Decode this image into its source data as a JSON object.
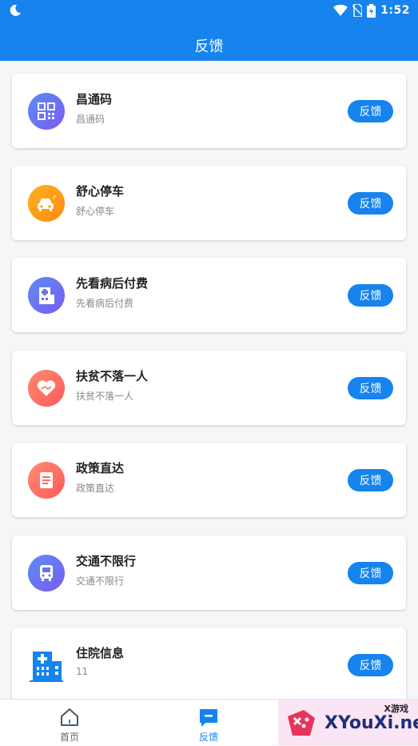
{
  "status_bar": {
    "time": "1:52"
  },
  "header": {
    "title": "反馈"
  },
  "items": [
    {
      "title": "昌通码",
      "subtitle": "昌通码",
      "button": "反馈",
      "icon": "qr-code-icon",
      "color": "#6a72f0"
    },
    {
      "title": "舒心停车",
      "subtitle": "舒心停车",
      "button": "反馈",
      "icon": "parking-car-icon",
      "color": "#ff9a1a"
    },
    {
      "title": "先看病后付费",
      "subtitle": "先看病后付费",
      "button": "反馈",
      "icon": "hospital-icon",
      "color": "#6a72f0"
    },
    {
      "title": "扶贫不落一人",
      "subtitle": "扶贫不落一人",
      "button": "反馈",
      "icon": "heart-handshake-icon",
      "color": "#ff6e5c"
    },
    {
      "title": "政策直达",
      "subtitle": "政策直达",
      "button": "反馈",
      "icon": "document-icon",
      "color": "#ff6e5c"
    },
    {
      "title": "交通不限行",
      "subtitle": "交通不限行",
      "button": "反馈",
      "icon": "bus-icon",
      "color": "#6a72f0"
    },
    {
      "title": "住院信息",
      "subtitle": "11",
      "button": "反馈",
      "icon": "hospital-building-icon",
      "color": "#1683ee"
    }
  ],
  "tabbar": {
    "tabs": [
      {
        "label": "首页",
        "icon": "home-icon",
        "active": false
      },
      {
        "label": "反馈",
        "icon": "feedback-icon",
        "active": true
      }
    ]
  },
  "watermark": {
    "small": "X游戏",
    "big": "XYouXi.net"
  },
  "colors": {
    "accent": "#1683ee",
    "background": "#f5f6f8"
  }
}
